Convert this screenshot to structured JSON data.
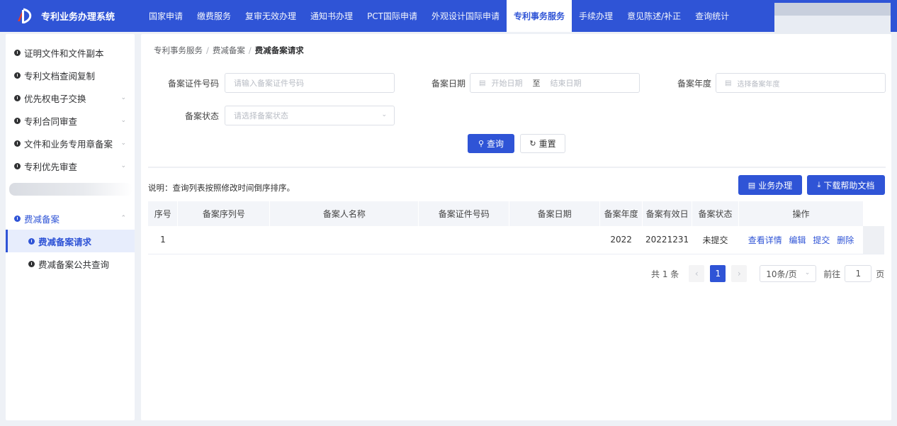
{
  "app": {
    "title": "专利业务办理系统"
  },
  "nav": {
    "items": [
      {
        "label": "国家申请"
      },
      {
        "label": "缴费服务"
      },
      {
        "label": "复审无效办理"
      },
      {
        "label": "通知书办理"
      },
      {
        "label": "PCT国际申请"
      },
      {
        "label": "外观设计国际申请"
      },
      {
        "label": "专利事务服务",
        "active": true
      },
      {
        "label": "手续办理"
      },
      {
        "label": "意见陈述/补正"
      },
      {
        "label": "查询统计"
      }
    ]
  },
  "sidebar": {
    "items": [
      {
        "label": "证明文件和文件副本"
      },
      {
        "label": "专利文档查阅复制"
      },
      {
        "label": "优先权电子交换"
      },
      {
        "label": "专利合同审查"
      },
      {
        "label": "文件和业务专用章备案"
      },
      {
        "label": "专利优先审查"
      }
    ],
    "section": {
      "label": "费减备案"
    },
    "sub_items": [
      {
        "label": "费减备案请求"
      },
      {
        "label": "费减备案公共查询"
      }
    ]
  },
  "breadcrumb": [
    "专利事务服务",
    "费减备案",
    "费减备案请求"
  ],
  "form": {
    "cert_label": "备案证件号码",
    "cert_placeholder": "请输入备案证件号码",
    "date_label": "备案日期",
    "date_start": "开始日期",
    "date_to": "至",
    "date_end": "结束日期",
    "year_label": "备案年度",
    "year_placeholder": "选择备案年度",
    "status_label": "备案状态",
    "status_placeholder": "请选择备案状态",
    "search_label": "查询",
    "reset_label": "重置"
  },
  "note": "说明：查询列表按照修改时间倒序排序。",
  "actions": {
    "business": "业务办理",
    "download": "下载帮助文档"
  },
  "table": {
    "columns": [
      "序号",
      "备案序列号",
      "备案人名称",
      "备案证件号码",
      "备案日期",
      "备案年度",
      "备案有效日",
      "备案状态",
      "操作"
    ],
    "rows": [
      {
        "index": "1",
        "serial": "",
        "name": "",
        "cert": "",
        "date": "",
        "year": "2022",
        "valid": "20221231",
        "status": "未提交",
        "ops": [
          "查看详情",
          "编辑",
          "提交",
          "删除"
        ]
      }
    ]
  },
  "pager": {
    "total": "共 1 条",
    "current": "1",
    "size": "10条/页",
    "goto": "前往",
    "goto_value": "1",
    "page_unit": "页"
  },
  "colors": {
    "primary": "#2f54d6",
    "bg": "#eef1f6"
  }
}
